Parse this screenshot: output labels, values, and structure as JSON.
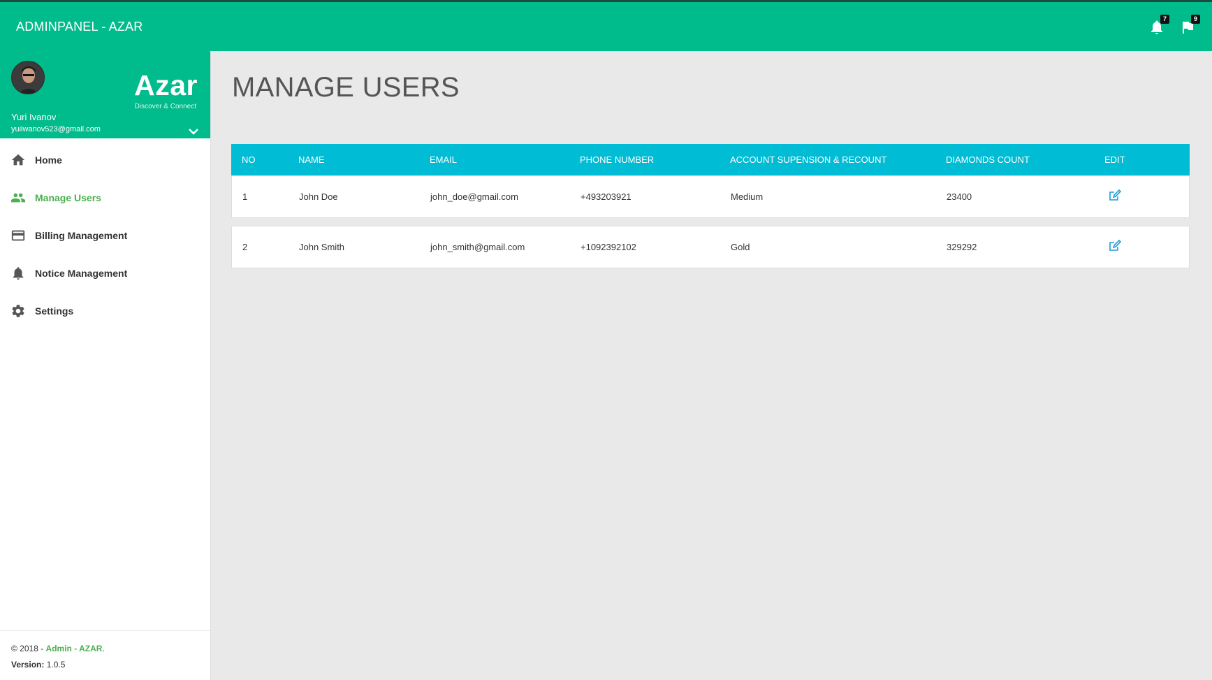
{
  "topbar": {
    "title": "ADMINPANEL - AZAR",
    "notifications_count": "7",
    "flags_count": "9"
  },
  "sidebar": {
    "logo": "Azar",
    "tagline": "Discover & Connect",
    "user_name": "Yuri Ivanov",
    "user_email": "yuiiwanov523@gmail.com",
    "items": [
      {
        "label": "Home",
        "icon": "home-icon"
      },
      {
        "label": "Manage Users",
        "icon": "users-icon",
        "active": true
      },
      {
        "label": "Billing Management",
        "icon": "credit-card-icon"
      },
      {
        "label": "Notice Management",
        "icon": "bell-icon"
      },
      {
        "label": "Settings",
        "icon": "gear-icon"
      }
    ],
    "footer": {
      "copyright_prefix": "© 2018 - ",
      "copyright_link": "Admin - AZAR",
      "copyright_suffix": ".",
      "version_label": "Version:",
      "version_value": " 1.0.5"
    }
  },
  "main": {
    "title": "MANAGE USERS",
    "table": {
      "headers": [
        "NO",
        "NAME",
        "EMAIL",
        "PHONE NUMBER",
        "ACCOUNT SUPENSION & RECOUNT",
        "DIAMONDS COUNT",
        "EDIT"
      ],
      "rows": [
        {
          "no": "1",
          "name": "John Doe",
          "email": "john_doe@gmail.com",
          "phone": "+493203921",
          "account": "Medium",
          "diamonds": "23400"
        },
        {
          "no": "2",
          "name": "John Smith",
          "email": "john_smith@gmail.com",
          "phone": "+1092392102",
          "account": "Gold",
          "diamonds": "329292"
        }
      ]
    }
  },
  "colors": {
    "primary": "#00bb8b",
    "table_header": "#00bcd4",
    "active": "#4caf50"
  }
}
